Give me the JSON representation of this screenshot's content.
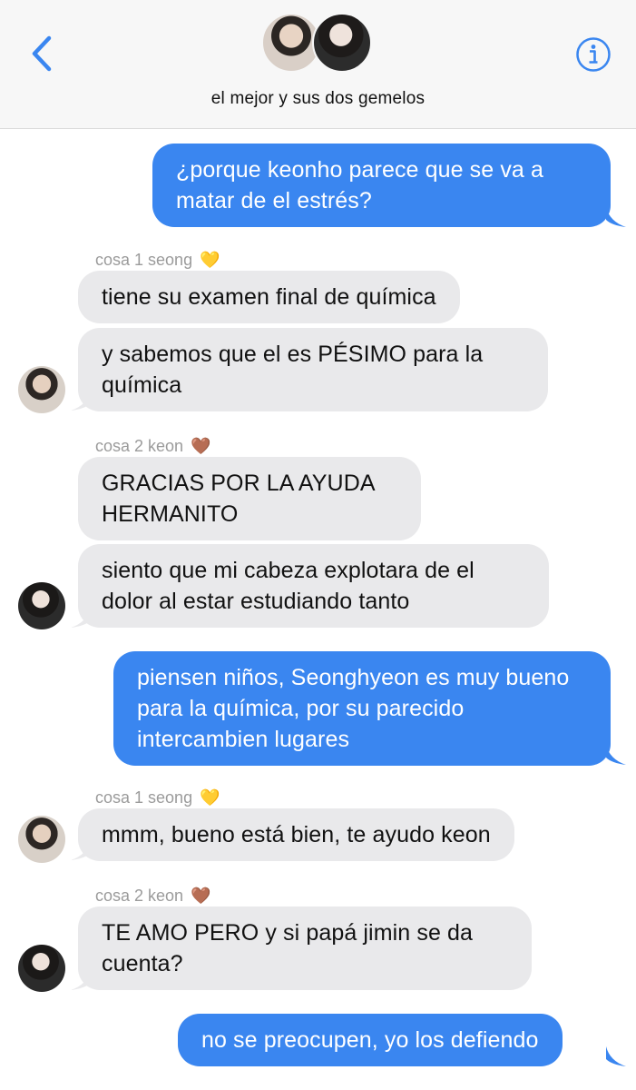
{
  "header": {
    "group_name": "el mejor y sus dos gemelos",
    "back_icon": "chevron-left-icon",
    "info_icon": "info-icon",
    "accent_color": "#3a86f0"
  },
  "senders": {
    "seong": {
      "name": "cosa 1 seong",
      "emoji": "💛"
    },
    "keon": {
      "name": "cosa 2 keon",
      "emoji": "🤎"
    }
  },
  "messages": [
    {
      "from": "me",
      "text": "¿porque keonho parece que se va a matar de el estrés?"
    },
    {
      "from": "seong",
      "text": "tiene su examen final de química"
    },
    {
      "from": "seong",
      "text": "y sabemos que el es PÉSIMO para la química"
    },
    {
      "from": "keon",
      "text": "GRACIAS POR LA AYUDA HERMANITO"
    },
    {
      "from": "keon",
      "text": "siento que mi cabeza explotara de el dolor al estar estudiando tanto"
    },
    {
      "from": "me",
      "text": "piensen niños, Seonghyeon es muy bueno para la química, por su parecido intercambien lugares"
    },
    {
      "from": "seong",
      "text": "mmm, bueno está bien, te ayudo keon"
    },
    {
      "from": "keon",
      "text": "TE AMO PERO y si papá jimin se da cuenta?"
    },
    {
      "from": "me",
      "text": "no se preocupen, yo los defiendo"
    }
  ]
}
